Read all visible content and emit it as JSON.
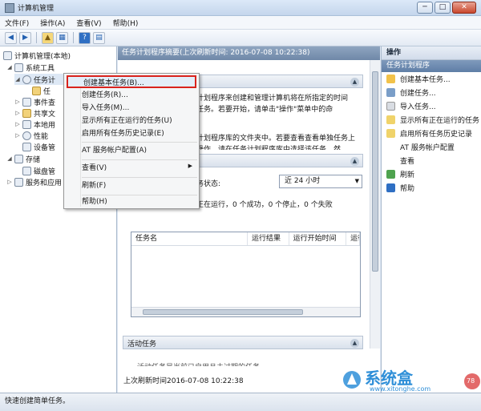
{
  "window": {
    "title": "计算机管理",
    "minimize": "─",
    "maximize": "□",
    "close": "✕"
  },
  "menubar": [
    "文件(F)",
    "操作(A)",
    "查看(V)",
    "帮助(H)"
  ],
  "toolbar_icons": [
    "back-arrow-icon",
    "forward-arrow-icon",
    "up-folder-icon",
    "show-tree-icon",
    "help-icon",
    "properties-icon"
  ],
  "tree": [
    {
      "label": "计算机管理(本地)",
      "indent": 0,
      "toggle": ""
    },
    {
      "label": "系统工具",
      "indent": 1,
      "toggle": "◢"
    },
    {
      "label": "任务计",
      "indent": 2,
      "toggle": "◢"
    },
    {
      "label": "任",
      "indent": 3,
      "toggle": ""
    },
    {
      "label": "事件查",
      "indent": 2,
      "toggle": "▷"
    },
    {
      "label": "共享文",
      "indent": 2,
      "toggle": "▷"
    },
    {
      "label": "本地用",
      "indent": 2,
      "toggle": "▷"
    },
    {
      "label": "性能",
      "indent": 2,
      "toggle": "▷"
    },
    {
      "label": "设备管",
      "indent": 2,
      "toggle": ""
    },
    {
      "label": "存储",
      "indent": 1,
      "toggle": "◢"
    },
    {
      "label": "磁盘管",
      "indent": 2,
      "toggle": ""
    },
    {
      "label": "服务和应用",
      "indent": 1,
      "toggle": "▷"
    }
  ],
  "center": {
    "header": "任务计划程序摘要(上次刷新时间: 2016-07-08 10:22:38)",
    "desc_lines": [
      "计划程序来创建和管理计算机将在所指定的时间",
      "任务。若要开始，请单击\"操作\"菜单中的命",
      "计划程序库的文件夹中。若要查看查看单独任务上",
      "操作，请在任务计划程序库中选择该任务，然"
    ],
    "status_label": "务状态:",
    "status_select": "近 24 小时",
    "status_text": "正在运行，0 个成功，0 个停止，0 个失败",
    "columns": [
      "任务名",
      "运行结果",
      "运行开始时间",
      "运行"
    ],
    "active_tasks": "活动任务",
    "active_text": "活动任务是当前已启用且未过期的任务。",
    "last_refresh": "上次刷新时间2016-07-08 10:22:38"
  },
  "context_menu": {
    "items": [
      "创建基本任务(B)...",
      "创建任务(R)...",
      "导入任务(M)...",
      "显示所有正在运行的任务(U)",
      "启用所有任务历史记录(E)",
      "AT 服务帐户配置(A)",
      "查看(V)",
      "刷新(F)",
      "帮助(H)"
    ],
    "submenu_arrow": "▶"
  },
  "actions": {
    "header": "操作",
    "subheader": "任务计划程序",
    "items": [
      {
        "label": "创建基本任务...",
        "icon": "create-basic-task-icon",
        "color": "#f2c24a"
      },
      {
        "label": "创建任务...",
        "icon": "create-task-icon",
        "color": "#7a9ec8"
      },
      {
        "label": "导入任务...",
        "icon": "import-task-icon",
        "color": "#d9dde3"
      },
      {
        "label": "显示所有正在运行的任务",
        "icon": "running-tasks-icon",
        "color": "#f0d36a"
      },
      {
        "label": "启用所有任务历史记录",
        "icon": "history-icon",
        "color": "#f0d36a"
      },
      {
        "label": "AT 服务帐户配置",
        "icon": "",
        "color": ""
      },
      {
        "label": "查看",
        "icon": "",
        "color": ""
      },
      {
        "label": "刷新",
        "icon": "refresh-icon",
        "color": "#4fa34f"
      },
      {
        "label": "帮助",
        "icon": "help-icon",
        "color": "#2f6fc3"
      }
    ]
  },
  "statusbar": "快速创建简单任务。",
  "watermark": {
    "text": "系统盒",
    "url": "www.xitonghe.com",
    "badge": "78"
  }
}
